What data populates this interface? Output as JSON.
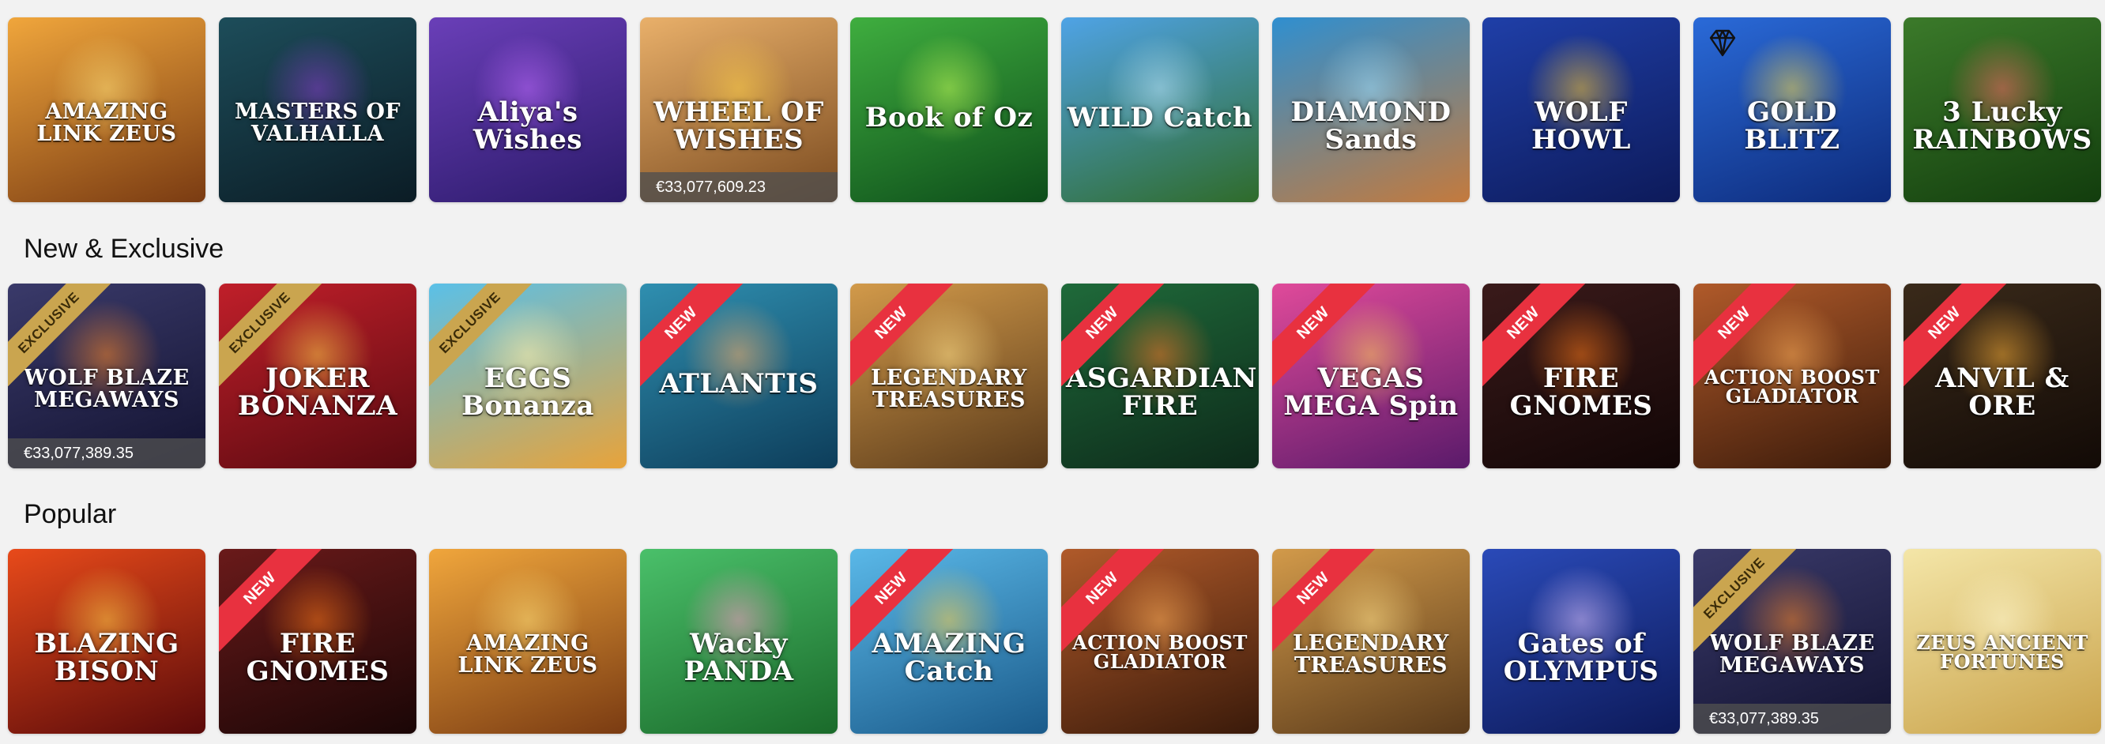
{
  "sections": [
    {
      "title": "",
      "games": [
        {
          "name": "AMAZING LINK ZEUS",
          "bg": [
            "#f0a63c",
            "#7a3b12"
          ],
          "glow": "#ffe07a",
          "jackpot": "",
          "ribbon": ""
        },
        {
          "name": "MASTERS OF VALHALLA",
          "bg": [
            "#1d4d5a",
            "#0b1c25"
          ],
          "glow": "#8b3fd1",
          "jackpot": "",
          "ribbon": ""
        },
        {
          "name": "Aliya's Wishes",
          "bg": [
            "#6a3fb8",
            "#2b1a6a"
          ],
          "glow": "#c06bff",
          "jackpot": "",
          "ribbon": ""
        },
        {
          "name": "WHEEL OF WISHES",
          "bg": [
            "#e9b06a",
            "#7a4a1f"
          ],
          "glow": "#ffd24a",
          "jackpot": "€33,077,609.23",
          "ribbon": ""
        },
        {
          "name": "Book of Oz",
          "bg": [
            "#3fae3f",
            "#0d4d1a"
          ],
          "glow": "#c6ff5a",
          "jackpot": "",
          "ribbon": ""
        },
        {
          "name": "WILD Catch",
          "bg": [
            "#4fa3e6",
            "#2f6b2a"
          ],
          "glow": "#bfe8ff",
          "jackpot": "",
          "ribbon": ""
        },
        {
          "name": "DIAMOND Sands",
          "bg": [
            "#2f8fd0",
            "#c47a3d"
          ],
          "glow": "#9fe0ff",
          "jackpot": "",
          "ribbon": ""
        },
        {
          "name": "WOLF HOWL",
          "bg": [
            "#1f3fa8",
            "#0d1a5a"
          ],
          "glow": "#ffcc33",
          "jackpot": "",
          "ribbon": ""
        },
        {
          "name": "GOLD BLITZ",
          "bg": [
            "#2a6ad8",
            "#0d2a7a"
          ],
          "glow": "#ffe14a",
          "jackpot": "",
          "ribbon": "",
          "diamond": true
        },
        {
          "name": "3 Lucky RAINBOWS",
          "bg": [
            "#3b7a2a",
            "#123d0d"
          ],
          "glow": "#ff6a6a",
          "jackpot": "",
          "ribbon": ""
        }
      ]
    },
    {
      "title": "New & Exclusive",
      "games": [
        {
          "name": "WOLF BLAZE MEGAWAYS",
          "bg": [
            "#3a3a6a",
            "#121230"
          ],
          "glow": "#ff8a2a",
          "jackpot": "€33,077,389.35",
          "ribbon": "EXCLUSIVE"
        },
        {
          "name": "JOKER BONANZA",
          "bg": [
            "#c01f2a",
            "#5a0a10"
          ],
          "glow": "#ffcf4a",
          "jackpot": "",
          "ribbon": "EXCLUSIVE"
        },
        {
          "name": "EGGS Bonanza",
          "bg": [
            "#5ac0e8",
            "#e8a33a"
          ],
          "glow": "#fff3b0",
          "jackpot": "",
          "ribbon": "EXCLUSIVE"
        },
        {
          "name": "ATLANTIS",
          "bg": [
            "#2f8fb0",
            "#0d3d5a"
          ],
          "glow": "#ffb36a",
          "jackpot": "",
          "ribbon": "NEW"
        },
        {
          "name": "LEGENDARY TREASURES",
          "bg": [
            "#d29a4a",
            "#5a3a1a"
          ],
          "glow": "#ffe08a",
          "jackpot": "",
          "ribbon": "NEW"
        },
        {
          "name": "ASGARDIAN FIRE",
          "bg": [
            "#1f6a3a",
            "#0d2a1a"
          ],
          "glow": "#ff7a2a",
          "jackpot": "",
          "ribbon": "NEW"
        },
        {
          "name": "VEGAS MEGA Spin",
          "bg": [
            "#e04a9a",
            "#5a1a6a"
          ],
          "glow": "#ffd05a",
          "jackpot": "",
          "ribbon": "NEW"
        },
        {
          "name": "FIRE GNOMES",
          "bg": [
            "#3a1a1a",
            "#120606"
          ],
          "glow": "#ff7a1a",
          "jackpot": "",
          "ribbon": "NEW"
        },
        {
          "name": "ACTION BOOST GLADIATOR",
          "bg": [
            "#b05a2a",
            "#3a1a0a"
          ],
          "glow": "#ffb05a",
          "jackpot": "",
          "ribbon": "NEW"
        },
        {
          "name": "ANVIL & ORE",
          "bg": [
            "#3a2a1a",
            "#120a06"
          ],
          "glow": "#ffb33a",
          "jackpot": "",
          "ribbon": "NEW"
        }
      ]
    },
    {
      "title": "Popular",
      "games": [
        {
          "name": "BLAZING BISON",
          "bg": [
            "#e84a1a",
            "#5a0a0a"
          ],
          "glow": "#ffd04a",
          "jackpot": "",
          "ribbon": ""
        },
        {
          "name": "FIRE GNOMES",
          "bg": [
            "#6a1a1a",
            "#1a0606"
          ],
          "glow": "#ff7a1a",
          "jackpot": "",
          "ribbon": "NEW"
        },
        {
          "name": "AMAZING LINK ZEUS",
          "bg": [
            "#f0a63c",
            "#7a3b12"
          ],
          "glow": "#ffe07a",
          "jackpot": "",
          "ribbon": ""
        },
        {
          "name": "Wacky PANDA",
          "bg": [
            "#4ac06a",
            "#1a6a2a"
          ],
          "glow": "#ff9acb",
          "jackpot": "",
          "ribbon": ""
        },
        {
          "name": "AMAZING Catch",
          "bg": [
            "#5ab8e8",
            "#1a5a8a"
          ],
          "glow": "#ffd34a",
          "jackpot": "",
          "ribbon": "NEW"
        },
        {
          "name": "ACTION BOOST GLADIATOR",
          "bg": [
            "#b05a2a",
            "#3a1a0a"
          ],
          "glow": "#ffb05a",
          "jackpot": "",
          "ribbon": "NEW"
        },
        {
          "name": "LEGENDARY TREASURES",
          "bg": [
            "#d29a4a",
            "#5a3a1a"
          ],
          "glow": "#ffe08a",
          "jackpot": "",
          "ribbon": "NEW"
        },
        {
          "name": "Gates of OLYMPUS",
          "bg": [
            "#2a4ab8",
            "#0d1a5a"
          ],
          "glow": "#e0c4ff",
          "jackpot": "",
          "ribbon": ""
        },
        {
          "name": "WOLF BLAZE MEGAWAYS",
          "bg": [
            "#3a3a6a",
            "#121230"
          ],
          "glow": "#ff8a2a",
          "jackpot": "€33,077,389.35",
          "ribbon": "EXCLUSIVE"
        },
        {
          "name": "ZEUS ANCIENT FORTUNES",
          "bg": [
            "#f4e6a8",
            "#c9a24a"
          ],
          "glow": "#fff8d0",
          "jackpot": "",
          "ribbon": ""
        }
      ]
    }
  ]
}
